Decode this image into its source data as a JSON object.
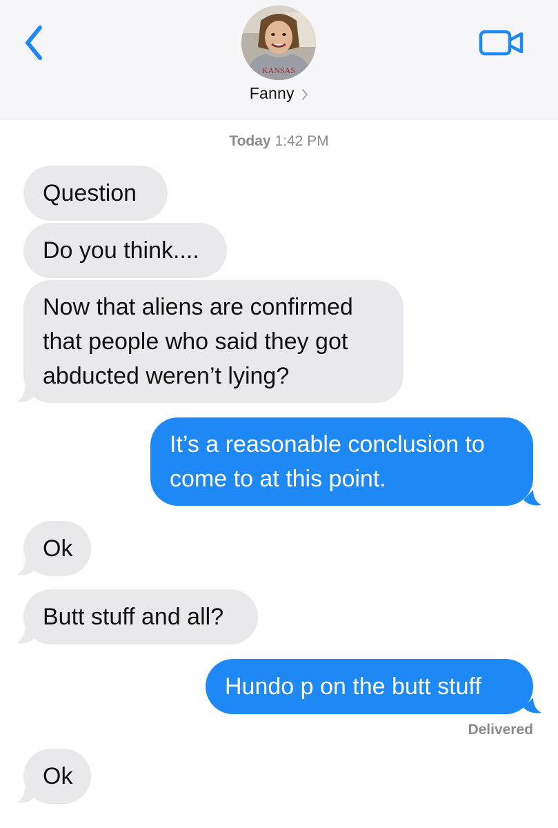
{
  "header": {
    "contact_name": "Fanny",
    "back_icon": "chevron-left-icon",
    "video_icon": "video-camera-icon",
    "avatar_caption": "KANSAS",
    "accent_color": "#1e88f5"
  },
  "conversation": {
    "timestamp_day": "Today",
    "timestamp_time": "1:42 PM",
    "messages": [
      {
        "side": "received",
        "text": "Question"
      },
      {
        "side": "received",
        "text": "Do you think...."
      },
      {
        "side": "received",
        "text": "Now that aliens are confirmed\nthat people who said they got\nabducted weren’t lying?"
      },
      {
        "side": "sent",
        "text": "It’s a reasonable conclusion to\ncome to at this point."
      },
      {
        "side": "received",
        "text": "Ok"
      },
      {
        "side": "received",
        "text": "Butt stuff and all?"
      },
      {
        "side": "sent",
        "text": "Hundo p on the butt stuff"
      },
      {
        "side": "received",
        "text": "Ok"
      }
    ],
    "delivery_status": "Delivered"
  },
  "colors": {
    "received_bubble": "#e9e9eb",
    "sent_bubble": "#1e88f5",
    "header_bg": "#f6f6f8"
  }
}
